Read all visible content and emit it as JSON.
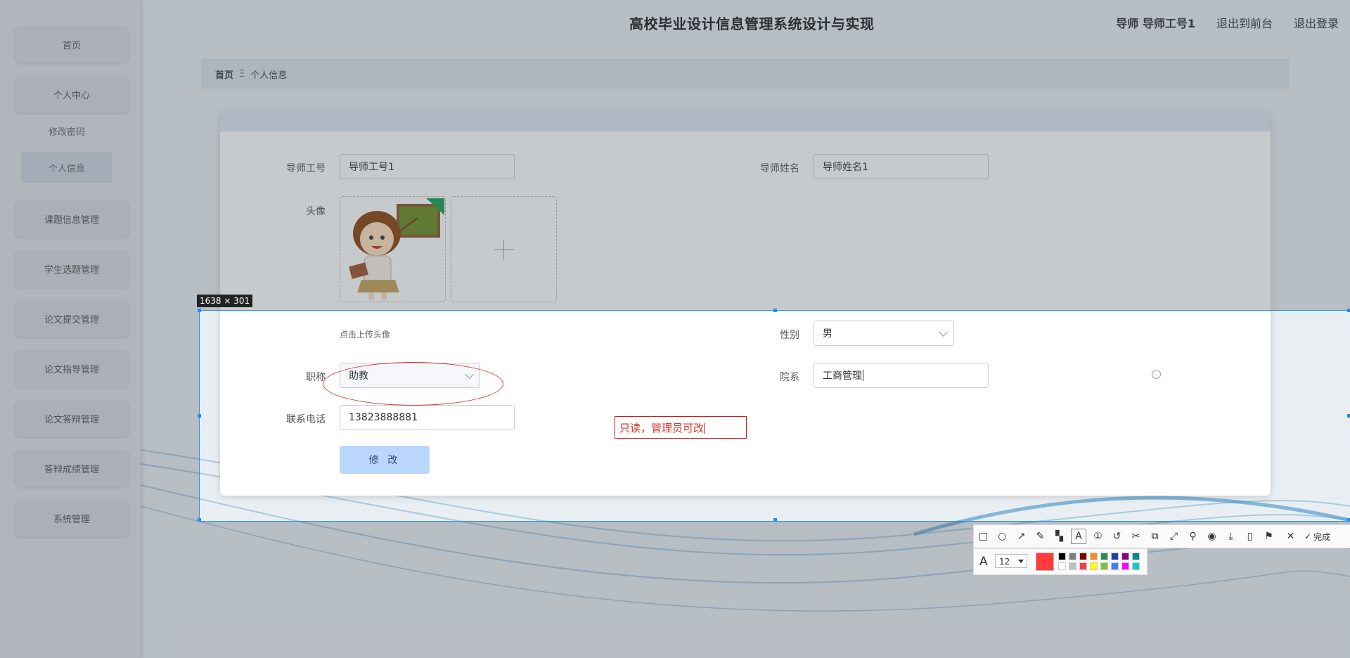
{
  "header": {
    "title": "高校毕业设计信息管理系统设计与实现",
    "user_label": "导师 导师工号1",
    "back_label": "退出到前台",
    "logout_label": "退出登录"
  },
  "sidebar": {
    "items": [
      {
        "label": "首页"
      },
      {
        "label": "个人中心"
      },
      {
        "label": "课题信息管理"
      },
      {
        "label": "学生选题管理"
      },
      {
        "label": "论文提交管理"
      },
      {
        "label": "论文指导管理"
      },
      {
        "label": "论文答辩管理"
      },
      {
        "label": "答辩成绩管理"
      },
      {
        "label": "系统管理"
      }
    ],
    "sub_items": [
      {
        "label": "修改密码"
      },
      {
        "label": "个人信息"
      }
    ]
  },
  "breadcrumb": {
    "home": "首页",
    "separator": "Ξ",
    "current": "个人信息"
  },
  "form": {
    "teacher_id_label": "导师工号",
    "teacher_id_value": "导师工号1",
    "teacher_name_label": "导师姓名",
    "teacher_name_value": "导师姓名1",
    "avatar_label": "头像",
    "upload_hint": "点击上传头像",
    "gender_label": "性别",
    "gender_value": "男",
    "title_label": "职称",
    "title_value": "助教",
    "department_label": "院系",
    "department_value": "工商管理",
    "phone_label": "联系电话",
    "phone_value": "13823888881",
    "submit_label": "修 改"
  },
  "screenshot_tool": {
    "size_label": "1638 × 301",
    "annotation_text": "只读，管理员可改",
    "done_label": "完成",
    "font_size": "12",
    "current_color": "#ff3b3b",
    "palette": [
      "#000000",
      "#808080",
      "#800000",
      "#f28c28",
      "#2e8b57",
      "#1e3fa8",
      "#8b008b",
      "#008b8b",
      "#ffffff",
      "#c0c0c0",
      "#ff3b3b",
      "#ffff00",
      "#7cc242",
      "#3b82f6",
      "#ff00ff",
      "#00ced1"
    ]
  }
}
